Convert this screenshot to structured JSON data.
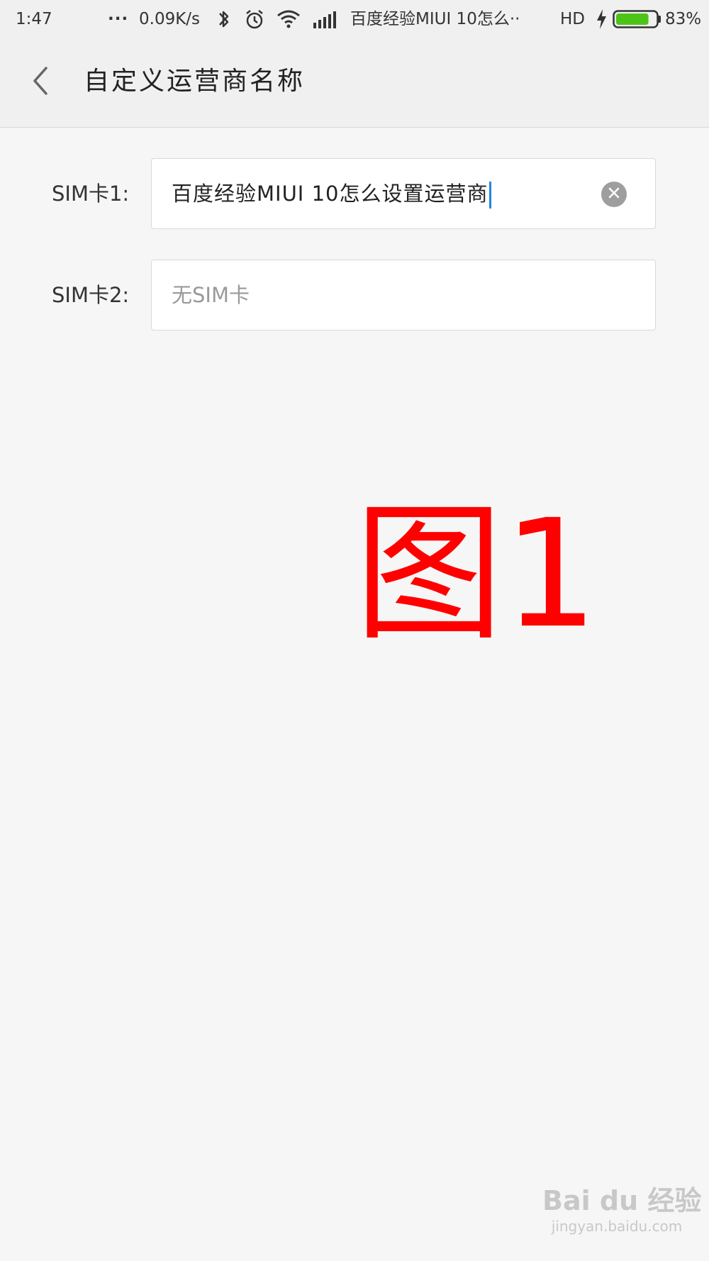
{
  "status_bar": {
    "time": "1:47",
    "dots": "...",
    "net_speed": "0.09K/s",
    "notification_text": "百度经验MIUI 10怎么··",
    "hd_label": "HD",
    "battery_percent": "83%",
    "battery_level": 0.83,
    "battery_color": "#4cc417",
    "icons": [
      "bluetooth-icon",
      "alarm-icon",
      "wifi-icon",
      "signal-icon",
      "charging-icon",
      "battery-icon"
    ]
  },
  "header": {
    "title": "自定义运营商名称",
    "back_icon": "chevron-left-icon"
  },
  "sim1": {
    "label": "SIM卡1:",
    "value": "百度经验MIUI 10怎么设置运营商",
    "clear_icon": "clear-icon"
  },
  "sim2": {
    "label": "SIM卡2:",
    "placeholder": "无SIM卡"
  },
  "annotation": {
    "text": "图1",
    "color": "#ff0000"
  },
  "watermark": {
    "brand": "Bai du 经验",
    "url": "jingyan.baidu.com"
  }
}
